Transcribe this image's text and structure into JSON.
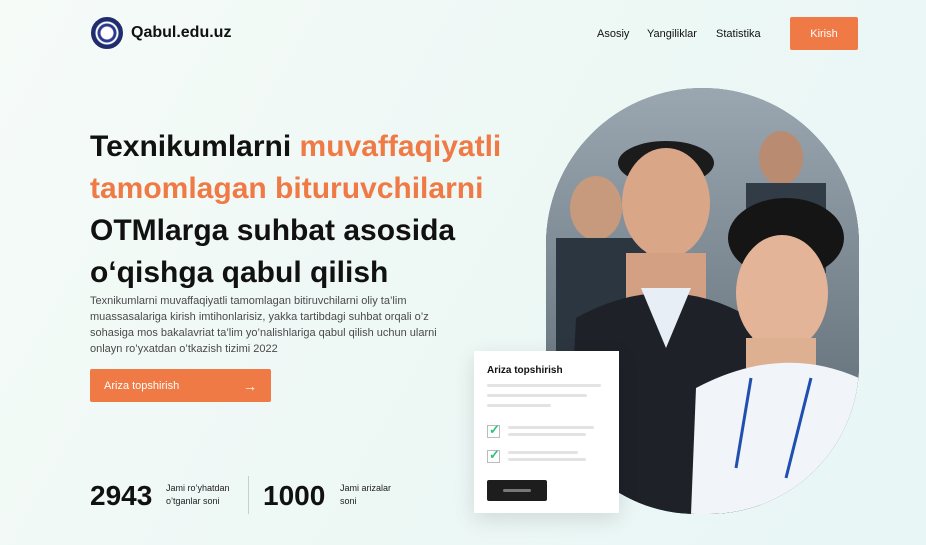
{
  "header": {
    "site_name": "Qabul.edu.uz",
    "logo_icon": "university-emblem-icon",
    "nav": [
      "Asosiy",
      "Yangiliklar",
      "Statistika"
    ],
    "login_label": "Kirish"
  },
  "hero": {
    "headline_part1": "Texnikumlarni ",
    "headline_accent": "muvaffaqiyatli tamomlagan bituruvchilarni",
    "headline_part2": " OTMlarga suhbat asosida oʻqishga qabul qilish",
    "description": "Texnikumlarni muvaffaqiyatli tamomlagan bitiruvchilarni oliy ta’lim muassasalariga kirish imtihonlarisiz, yakka tartibdagi suhbat orqali o’z sohasiga mos bakalavriat ta’lim yo’nalishlariga qabul qilish uchun ularni onlayn ro’yxatdan o’tkazish tizimi 2022",
    "cta_label": "Ariza topshirish",
    "cta_icon": "arrow-right-icon"
  },
  "stats": [
    {
      "value": "2943",
      "label": "Jami ro’yhatdan o’tganlar soni"
    },
    {
      "value": "1000",
      "label": "Jami arizalar soni"
    }
  ],
  "card": {
    "title": "Ariza topshirish",
    "check_icon": "check-icon",
    "accent_color": "#2ec27e"
  },
  "colors": {
    "accent": "#ef7a45",
    "text": "#111111"
  }
}
